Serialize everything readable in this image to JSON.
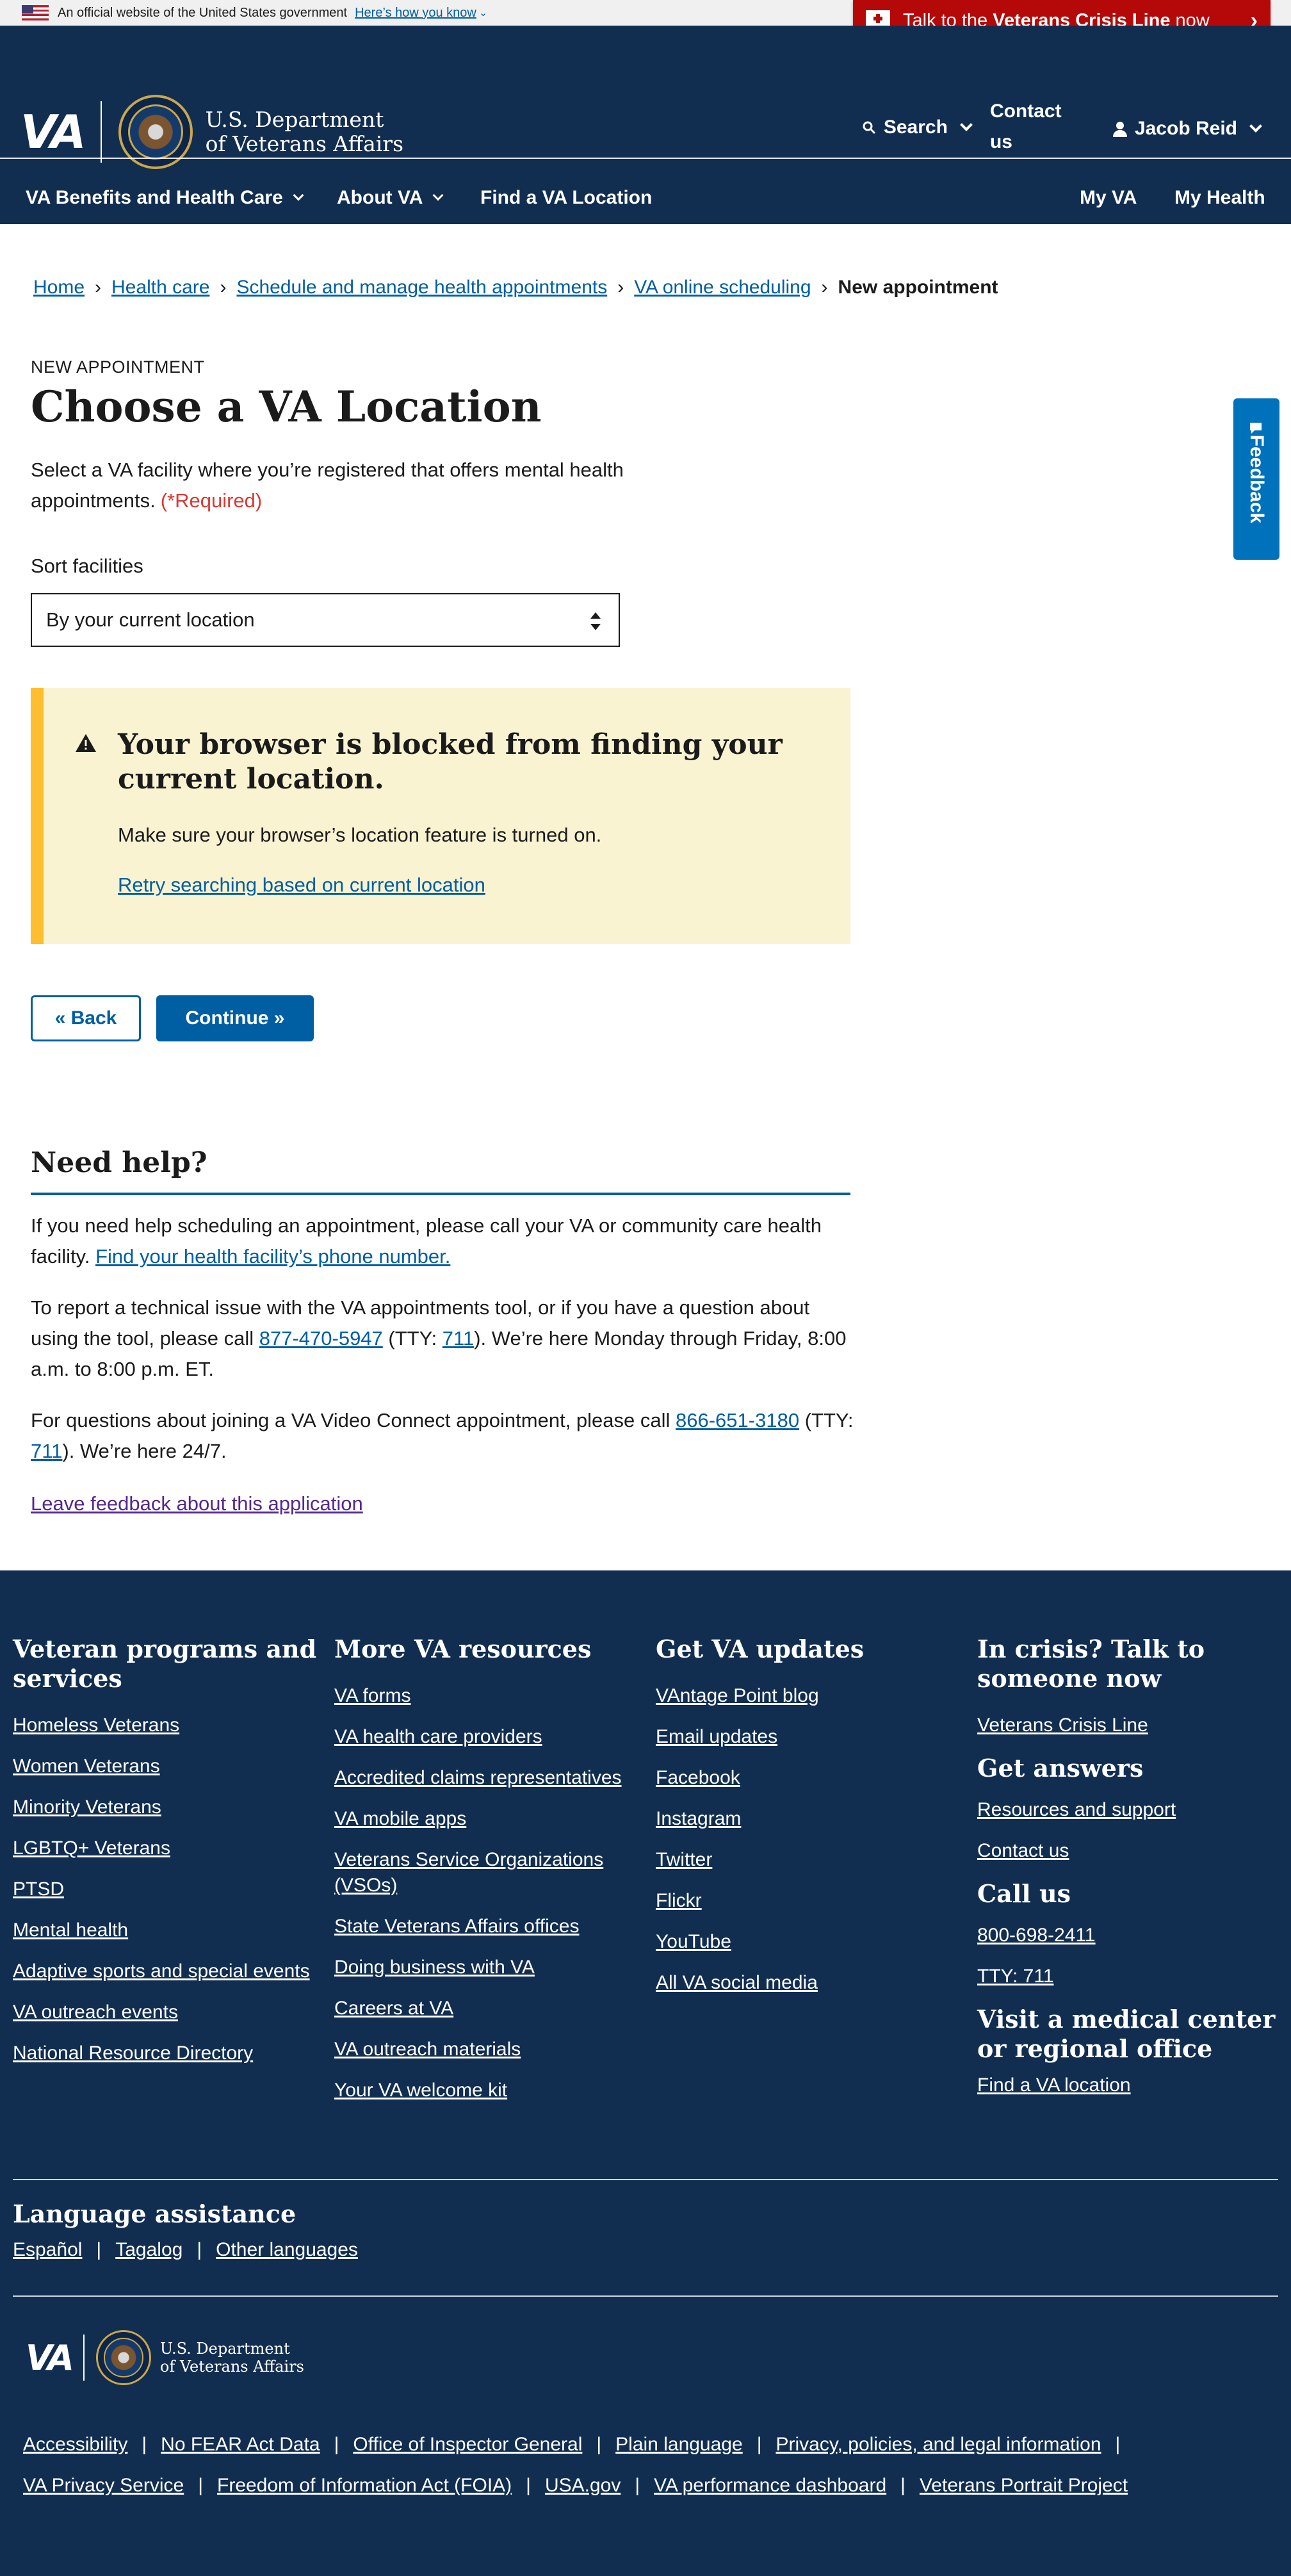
{
  "gov_banner": {
    "text": "An official website of the United States government",
    "link": "Here’s how you know"
  },
  "crisis_line": {
    "prefix": "Talk to the ",
    "bold": "Veterans Crisis Line",
    "suffix": " now"
  },
  "header": {
    "logo_mark": "VA",
    "dept_line1": "U.S. Department",
    "dept_line2": "of Veterans Affairs",
    "search": "Search",
    "contact": "Contact us",
    "user": "Jacob Reid"
  },
  "nav": {
    "benefits": "VA Benefits and Health Care",
    "about": "About VA",
    "find": "Find a VA Location",
    "my_va": "My VA",
    "my_health": "My Health"
  },
  "breadcrumb": {
    "home": "Home",
    "health_care": "Health care",
    "schedule": "Schedule and manage health appointments",
    "online": "VA online scheduling",
    "current": "New appointment"
  },
  "page": {
    "eyebrow": "NEW APPOINTMENT",
    "title": "Choose a VA Location",
    "description": "Select a VA facility where you’re registered that offers mental health appointments.",
    "required": "(*Required)",
    "sort_label": "Sort facilities",
    "sort_value": "By your current location"
  },
  "alert": {
    "heading": "Your browser is blocked from finding your current location.",
    "body": "Make sure your browser’s location feature is turned on.",
    "retry": "Retry searching based on current location"
  },
  "buttons": {
    "back": "« Back",
    "continue": "Continue »"
  },
  "help": {
    "heading": "Need help?",
    "p1_text": "If you need help scheduling an appointment, please call your VA or community care health facility. ",
    "p1_link": "Find your health facility’s phone number.",
    "p2_a": "To report a technical issue with the VA appointments tool, or if you have a question about using the tool, please call ",
    "p2_phone": "877-470-5947",
    "p2_b": " (TTY: ",
    "p2_tty": "711",
    "p2_c": "). We’re here Monday through Friday, 8:00 a.m. to 8:00 p.m. ET.",
    "p3_a": "For questions about joining a VA Video Connect appointment, please call ",
    "p3_phone": "866-651-3180",
    "p3_b": " (TTY: ",
    "p3_tty": "711",
    "p3_c": "). We’re here 24/7.",
    "feedback_link": "Leave feedback about this application"
  },
  "feedback_tab": "Feedback",
  "footer": {
    "col1": {
      "heading": "Veteran programs and services",
      "links": [
        "Homeless Veterans",
        "Women Veterans",
        "Minority Veterans",
        "LGBTQ+ Veterans",
        "PTSD",
        "Mental health",
        "Adaptive sports and special events",
        "VA outreach events",
        "National Resource Directory"
      ]
    },
    "col2": {
      "heading": "More VA resources",
      "links": [
        "VA forms",
        "VA health care providers",
        "Accredited claims representatives",
        "VA mobile apps",
        "Veterans Service Organizations (VSOs)",
        "State Veterans Affairs offices",
        "Doing business with VA",
        "Careers at VA",
        "VA outreach materials",
        "Your VA welcome kit"
      ]
    },
    "col3": {
      "heading": "Get VA updates",
      "links": [
        "VAntage Point blog",
        "Email updates",
        "Facebook",
        "Instagram",
        "Twitter",
        "Flickr",
        "YouTube",
        "All VA social media"
      ]
    },
    "col4": {
      "heading_crisis": "In crisis? Talk to someone now",
      "crisis_link": "Veterans Crisis Line",
      "heading_answers": "Get answers",
      "answers_links": [
        "Resources and support",
        "Contact us"
      ],
      "heading_call": "Call us",
      "call_links": [
        "800-698-2411",
        "TTY: 711"
      ],
      "heading_visit": "Visit a medical center or regional office",
      "visit_link": "Find a VA location"
    },
    "language": {
      "heading": "Language assistance",
      "links": [
        "Español",
        "Tagalog",
        "Other languages"
      ]
    },
    "legal_row1": [
      "Accessibility",
      "No FEAR Act Data",
      "Office of Inspector General",
      "Plain language",
      "Privacy, policies, and legal information"
    ],
    "legal_row2": [
      "VA Privacy Service",
      "Freedom of Information Act (FOIA)",
      "USA.gov",
      "VA performance dashboard",
      "Veterans Portrait Project"
    ]
  }
}
